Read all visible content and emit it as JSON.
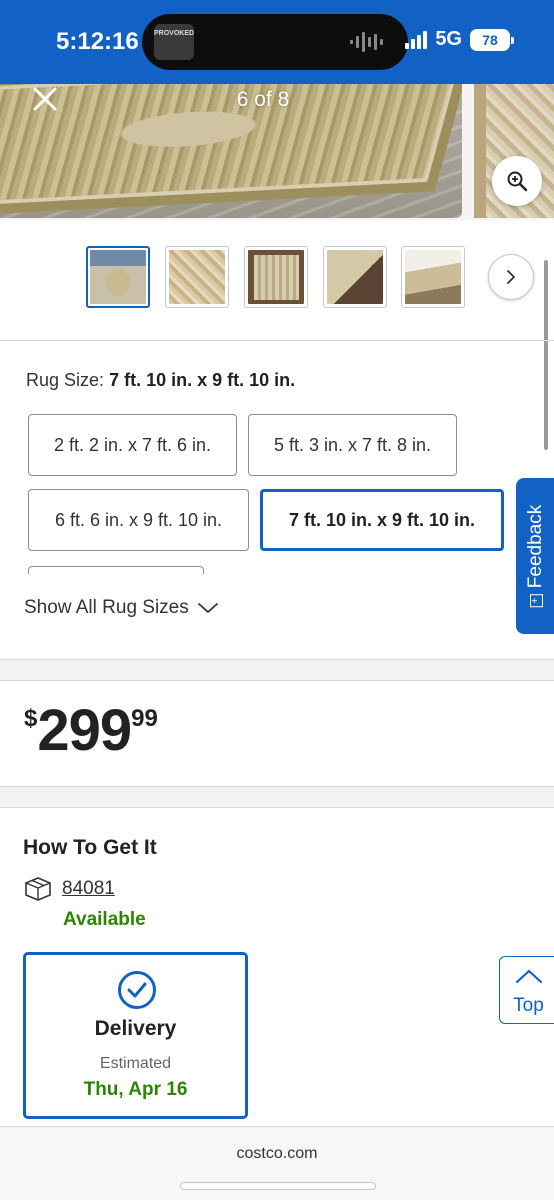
{
  "status_bar": {
    "time": "5:12:16",
    "overlay_text": "PROVOKED",
    "network": "5G",
    "battery": "78"
  },
  "gallery": {
    "photo_counter": "6 of 8",
    "close_icon": "close-icon",
    "zoom_icon": "zoom-in-icon",
    "thumbnail_count_visible": 5,
    "active_thumbnail": 1
  },
  "rug_size": {
    "label": "Rug Size:",
    "selected_value": "7 ft. 10 in. x 9 ft. 10 in.",
    "options": [
      "2 ft. 2 in. x 7 ft. 6 in.",
      "5 ft. 3 in. x 7 ft. 8 in.",
      "6 ft. 6 in. x 9 ft. 10 in.",
      "7 ft. 10 in. x 9 ft. 10 in."
    ],
    "show_all": "Show All Rug Sizes"
  },
  "feedback": {
    "label": "Feedback",
    "icon": "[+]"
  },
  "price": {
    "currency": "$",
    "dollars": "299",
    "cents": "99"
  },
  "how_to_get_it": {
    "title": "How To Get It",
    "zip": "84081",
    "availability": "Available",
    "delivery": {
      "title": "Delivery",
      "estimated_label": "Estimated",
      "date": "Thu, Apr 16"
    }
  },
  "top_button": {
    "label": "Top"
  },
  "browser": {
    "domain": "costco.com"
  },
  "colors": {
    "brand_blue": "#1162c4",
    "available_green": "#2a8703"
  }
}
